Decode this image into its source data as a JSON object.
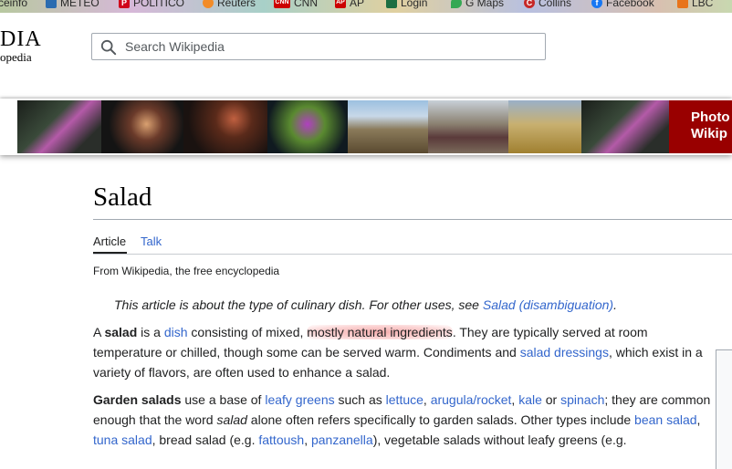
{
  "bookmarks": [
    {
      "label": "ceinfo",
      "icon": "bookmark-icon",
      "color": "#5a8a3a"
    },
    {
      "label": "METEO",
      "icon": "meteo-icon",
      "color": "#2b6cb0"
    },
    {
      "label": "POLITICO",
      "icon": "politico-icon",
      "color": "#d0021b"
    },
    {
      "label": "Reuters",
      "icon": "reuters-icon",
      "color": "#f28c28"
    },
    {
      "label": "CNN",
      "icon": "cnn-icon",
      "color": "#cc0000"
    },
    {
      "label": "AP",
      "icon": "ap-icon",
      "color": "#cc0000"
    },
    {
      "label": "Login",
      "icon": "login-icon",
      "color": "#1d6f42"
    },
    {
      "label": "G Maps",
      "icon": "maps-icon",
      "color": "#34a853"
    },
    {
      "label": "Collins",
      "icon": "collins-icon",
      "color": "#c62828"
    },
    {
      "label": "Facebook",
      "icon": "facebook-icon",
      "color": "#1877f2"
    },
    {
      "label": "LBC",
      "icon": "lbc-icon",
      "color": "#e8741b"
    }
  ],
  "header": {
    "logo_word": "DIA",
    "logo_tagline": "opedia",
    "search_placeholder": "Search Wikipedia"
  },
  "banner": {
    "cta_line1": "Photo",
    "cta_line2": "Wikip"
  },
  "article": {
    "title": "Salad",
    "tabs": {
      "article": "Article",
      "talk": "Talk"
    },
    "tagline": "From Wikipedia, the free encyclopedia",
    "hatnote": {
      "text": "This article is about the type of culinary dish. For other uses, see ",
      "link": "Salad (disambiguation)",
      "end": "."
    },
    "p1": {
      "t1": "A ",
      "b1": "salad",
      "t2": " is a ",
      "l1": "dish",
      "t3": " consisting of mixed, ",
      "h1": "mostly natural ingredients",
      "t4": ". They are typically served at room temperature or chilled, though some can be served warm. Condiments and ",
      "l2": "salad dressings",
      "t5": ", which exist in a variety of flavors, are often used to enhance a salad."
    },
    "p2": {
      "b1": "Garden salads",
      "t1": " use a base of ",
      "l1": "leafy greens",
      "t2": " such as ",
      "l2": "lettuce",
      "t3": ", ",
      "l3": "arugula/rocket",
      "t4": ", ",
      "l4": "kale",
      "t5": " or ",
      "l5": "spinach",
      "t6": "; they are common enough that the word ",
      "i1": "salad",
      "t7": " alone often refers specifically to garden salads. Other types include ",
      "l6": "bean salad",
      "t8": ", ",
      "l7": "tuna salad",
      "t9": ", bread salad (e.g. ",
      "l8": "fattoush",
      "t10": ", ",
      "l9": "panzanella",
      "t11": "), vegetable salads without leafy greens (e.g."
    }
  },
  "colors": {
    "link": "#3366cc",
    "text": "#202122",
    "banner_cta": "#990000",
    "highlight": "#ee6e6e"
  }
}
